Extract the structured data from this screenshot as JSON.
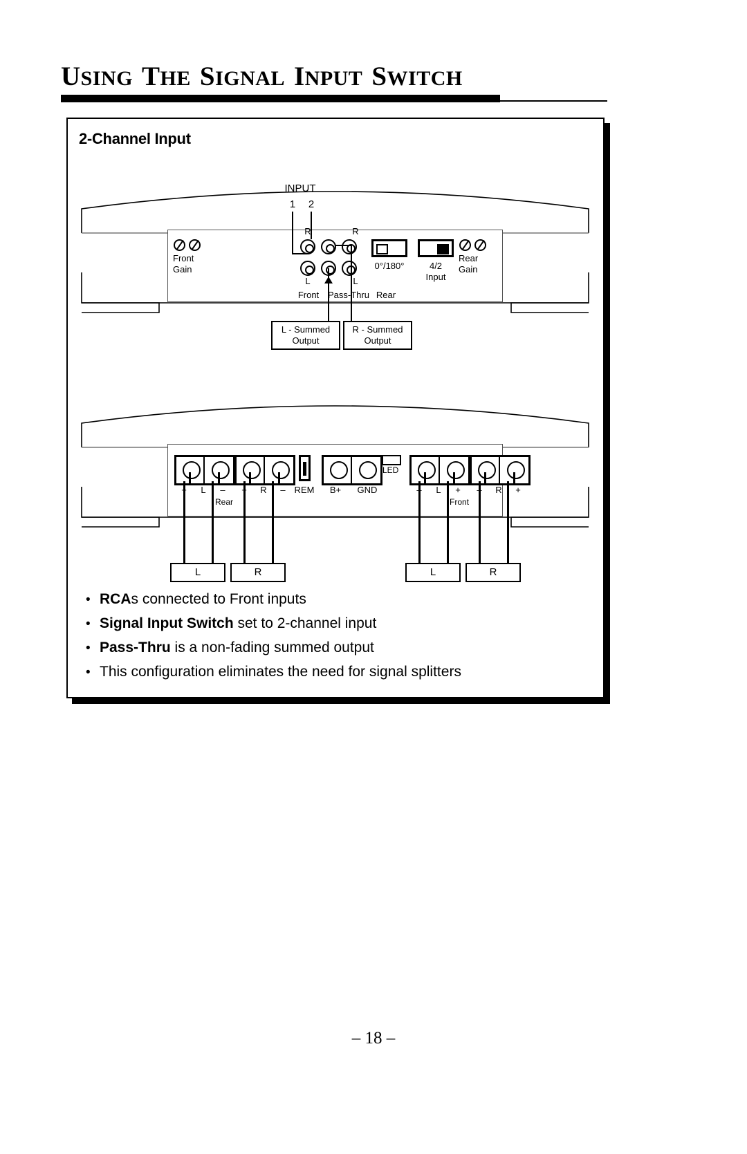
{
  "page": {
    "title_words": [
      "Using",
      "the",
      "Signal",
      "Input",
      "Switch"
    ],
    "number": "– 18 –"
  },
  "section": {
    "heading": "2-Channel Input"
  },
  "input_panel": {
    "input_label": "INPUT",
    "channel_1": "1",
    "channel_2": "2",
    "front_gain": "Front\nGain",
    "front_gain_line1": "Front",
    "front_gain_line2": "Gain",
    "rear_gain_line1": "Rear",
    "rear_gain_line2": "Gain",
    "jack_front_r": "R",
    "jack_front_l": "L",
    "jack_rear_r": "R",
    "jack_rear_l": "L",
    "group_front": "Front",
    "group_passthru": "Pass-Thru",
    "group_rear": "Rear",
    "switch_phase_label": "0°/180°",
    "switch_phase_position": "left",
    "switch_input_label_line1": "4/2",
    "switch_input_label_line2": "Input",
    "switch_input_position": "right",
    "summed_left_line1": "L - Summed",
    "summed_left_line2": "Output",
    "summed_right_line1": "R - Summed",
    "summed_right_line2": "Output"
  },
  "terminal_panel": {
    "rear_group_label": "Rear",
    "front_group_label": "Front",
    "led_label": "LED",
    "rem_label": "REM",
    "bplus_label": "B+",
    "gnd_label": "GND",
    "rear_l_minus": "+",
    "terminals": [
      {
        "name": "rear-l-plus",
        "label": "+"
      },
      {
        "name": "rear-l-mid",
        "label": "L"
      },
      {
        "name": "rear-l-minus",
        "label": "–"
      },
      {
        "name": "rear-r-plus",
        "label": "+"
      },
      {
        "name": "rear-r-mid",
        "label": "R"
      },
      {
        "name": "rear-r-minus",
        "label": "–"
      },
      {
        "name": "front-l-minus",
        "label": "–"
      },
      {
        "name": "front-l-mid",
        "label": "L"
      },
      {
        "name": "front-l-plus",
        "label": "+"
      },
      {
        "name": "front-r-minus",
        "label": "–"
      },
      {
        "name": "front-r-mid",
        "label": "R"
      },
      {
        "name": "front-r-plus",
        "label": "+"
      }
    ],
    "speaker_rear_l": "L",
    "speaker_rear_r": "R",
    "speaker_front_l": "L",
    "speaker_front_r": "R"
  },
  "notes": [
    {
      "bold": "RCA",
      "rest": "s connected to Front inputs"
    },
    {
      "bold": "Signal Input Switch",
      "rest": " set to 2-channel input"
    },
    {
      "bold": "Pass-Thru",
      "rest": " is a non-fading summed output"
    },
    {
      "bold": "",
      "rest": "This configuration eliminates the need for signal splitters"
    }
  ]
}
